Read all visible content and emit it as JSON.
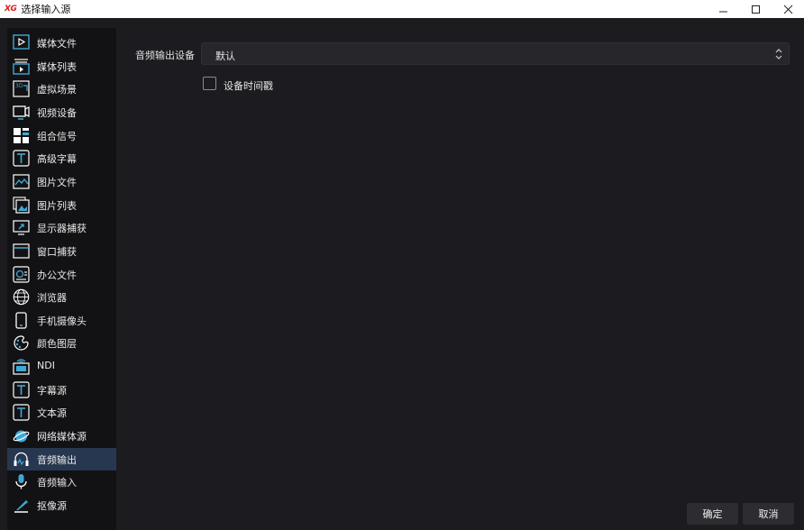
{
  "window": {
    "logo": "XG",
    "title": "选择输入源",
    "minimize_icon": "minimize-icon",
    "maximize_icon": "maximize-icon",
    "close_icon": "close-icon"
  },
  "sidebar": {
    "active_index": 19,
    "items": [
      {
        "label": "媒体文件",
        "icon": "media-file-icon"
      },
      {
        "label": "媒体列表",
        "icon": "media-list-icon"
      },
      {
        "label": "虚拟场景",
        "icon": "virtual-scene-icon"
      },
      {
        "label": "视频设备",
        "icon": "video-device-icon"
      },
      {
        "label": "组合信号",
        "icon": "combined-signal-icon"
      },
      {
        "label": "高级字幕",
        "icon": "advanced-subtitle-icon"
      },
      {
        "label": "图片文件",
        "icon": "image-file-icon"
      },
      {
        "label": "图片列表",
        "icon": "image-list-icon"
      },
      {
        "label": "显示器捕获",
        "icon": "display-capture-icon"
      },
      {
        "label": "窗口捕获",
        "icon": "window-capture-icon"
      },
      {
        "label": "办公文件",
        "icon": "office-file-icon"
      },
      {
        "label": "浏览器",
        "icon": "browser-icon"
      },
      {
        "label": "手机摄像头",
        "icon": "phone-camera-icon"
      },
      {
        "label": "颜色图层",
        "icon": "color-layer-icon"
      },
      {
        "label": "NDI",
        "icon": "ndi-icon"
      },
      {
        "label": "字幕源",
        "icon": "subtitle-source-icon"
      },
      {
        "label": "文本源",
        "icon": "text-source-icon"
      },
      {
        "label": "网络媒体源",
        "icon": "network-media-icon"
      },
      {
        "label": "音频输出",
        "icon": "audio-output-icon"
      },
      {
        "label": "音频输入",
        "icon": "audio-input-icon"
      },
      {
        "label": "抠像源",
        "icon": "keying-source-icon"
      }
    ]
  },
  "main": {
    "device_label": "音频输出设备",
    "device_value": "默认",
    "timestamp_label": "设备时间戳",
    "timestamp_checked": false
  },
  "footer": {
    "ok_label": "确定",
    "cancel_label": "取消"
  },
  "colors": {
    "accent": "#3fa9d6",
    "active_bg": "#27374f",
    "logo": "#d9201a"
  }
}
